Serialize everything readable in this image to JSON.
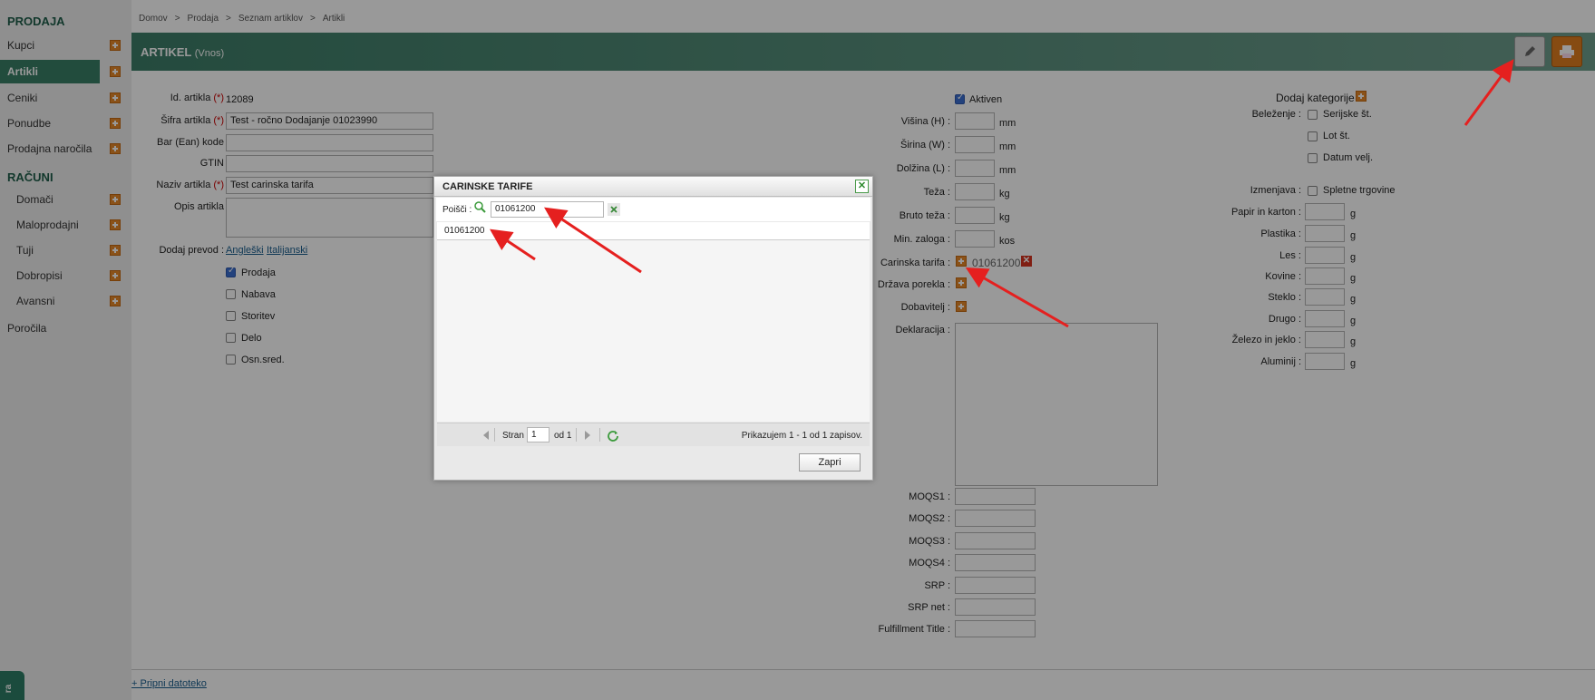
{
  "sidebar": {
    "section1": "PRODAJA",
    "items1": [
      "Kupci",
      "Artikli",
      "Ceniki",
      "Ponudbe",
      "Prodajna naročila"
    ],
    "section2": "RAČUNI",
    "items2": [
      "Domači",
      "Maloprodajni",
      "Tuji",
      "Dobropisi",
      "Avansni"
    ],
    "reports": "Poročila"
  },
  "breadcrumb": [
    "Domov",
    ">",
    "Prodaja",
    ">",
    "Seznam artiklov",
    ">",
    "Artikli"
  ],
  "page": {
    "title": "ARTIKEL",
    "mode": "(Vnos)"
  },
  "form": {
    "id_label": "Id. artikla",
    "id_value": "12089",
    "sifra_label": "Šifra artikla",
    "sifra_value": "Test - ročno Dodajanje 01023990",
    "ean_label": "Bar (Ean) kode",
    "gtin_label": "GTIN",
    "naziv_label": "Naziv artikla",
    "naziv_value": "Test carinska tarifa",
    "opis_label": "Opis artikla",
    "prevod_label": "Dodaj prevod :",
    "prevod_links": [
      "Angleški",
      "Italijanski"
    ],
    "req": "(*)",
    "types": [
      "Prodaja",
      "Nabava",
      "Storitev",
      "Delo",
      "Osn.sred."
    ]
  },
  "middle": {
    "aktiven": "Aktiven",
    "fields": [
      {
        "label": "Višina (H) :",
        "unit": "mm"
      },
      {
        "label": "Širina (W) :",
        "unit": "mm"
      },
      {
        "label": "Dolžina (L) :",
        "unit": "mm"
      },
      {
        "label": "Teža :",
        "unit": "kg"
      },
      {
        "label": "Bruto teža :",
        "unit": "kg"
      },
      {
        "label": "Min. zaloga :",
        "unit": "kos"
      }
    ],
    "carinska_label": "Carinska tarifa :",
    "carinska_value": "01061200",
    "drzava_label": "Država porekla :",
    "dobavitelj_label": "Dobavitelj :",
    "deklaracija_label": "Deklaracija :",
    "moqs": [
      "MOQS1 :",
      "MOQS2 :",
      "MOQS3 :",
      "MOQS4 :",
      "SRP :",
      "SRP net :",
      "Fulfillment Title :"
    ]
  },
  "right": {
    "dodaj_kat": "Dodaj kategorije",
    "belezenje_label": "Beleženje :",
    "belezenje_opts": [
      "Serijske št.",
      "Lot št.",
      "Datum velj."
    ],
    "izmenjava_label": "Izmenjava :",
    "izmenjava_opt": "Spletne trgovine",
    "materials": [
      "Papir in karton :",
      "Plastika :",
      "Les :",
      "Kovine :",
      "Steklo :",
      "Drugo :",
      "Železo in jeklo :",
      "Aluminij :"
    ],
    "unit": "g"
  },
  "footer": {
    "attach": "+ Pripni datoteko",
    "tab": "ra"
  },
  "dialog": {
    "title": "CARINSKE TARIFE",
    "search_label": "Poišči :",
    "search_value": "01061200",
    "row": "01061200",
    "page_label": "Stran",
    "page_value": "1",
    "of_label": "od 1",
    "status": "Prikazujem 1 - 1 od 1 zapisov.",
    "close_btn": "Zapri"
  }
}
